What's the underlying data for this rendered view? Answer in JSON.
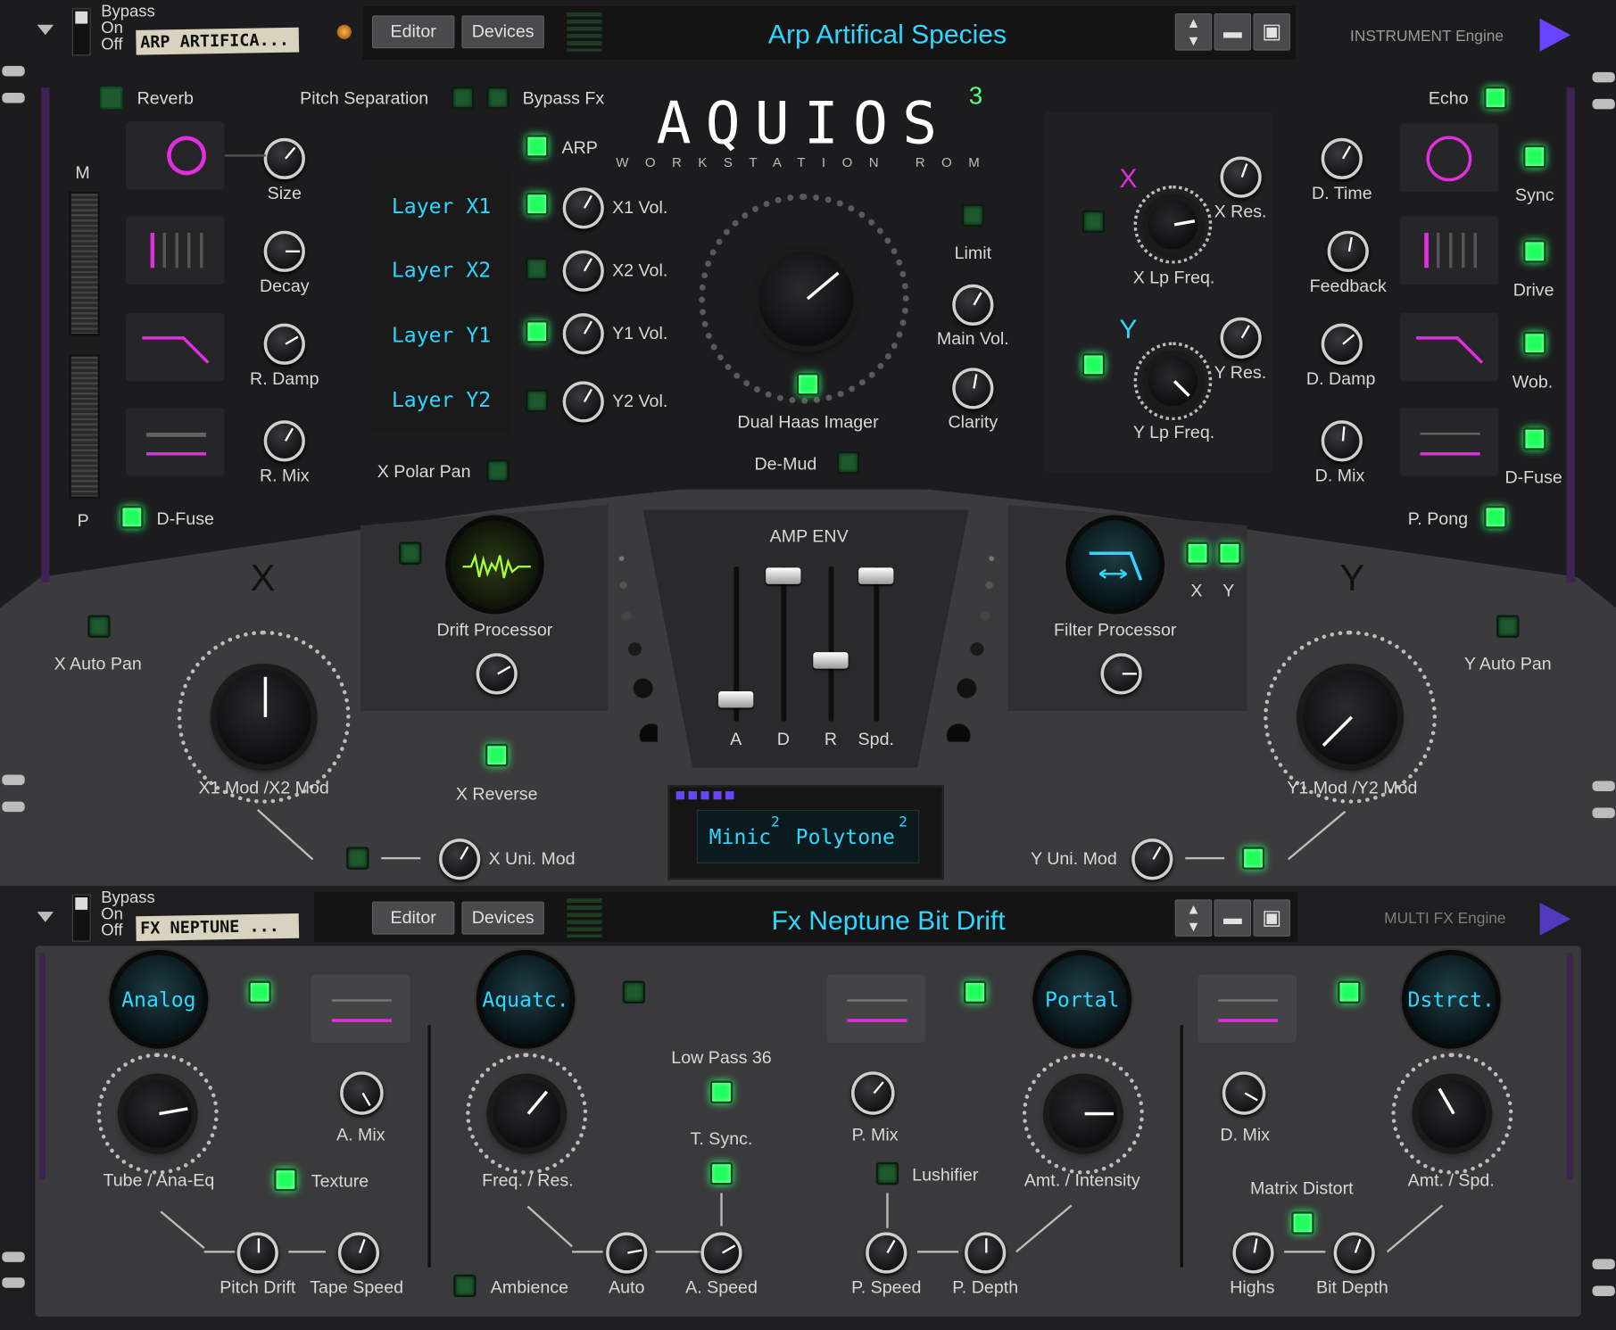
{
  "top_header": {
    "bypass": "Bypass",
    "on": "On",
    "off": "Off",
    "patch_tag": "ARP ARTIFICA...",
    "editor": "Editor",
    "devices": "Devices",
    "patch_name": "Arp Artifical Species",
    "engine": "INSTRUMENT Engine"
  },
  "logo": {
    "name": "AQUIOS",
    "sup": "3",
    "sub": "WORKSTATION ROM"
  },
  "reverb": {
    "title": "Reverb",
    "size": "Size",
    "decay": "Decay",
    "rdamp": "R. Damp",
    "rmix": "R. Mix",
    "dfuse": "D-Fuse",
    "m": "M",
    "p": "P"
  },
  "layers": {
    "pitch_sep": "Pitch Separation",
    "bypass_fx": "Bypass Fx",
    "arp": "ARP",
    "x1": "Layer X1",
    "x2": "Layer X2",
    "y1": "Layer Y1",
    "y2": "Layer Y2",
    "x1vol": "X1 Vol.",
    "x2vol": "X2 Vol.",
    "y1vol": "Y1 Vol.",
    "y2vol": "Y2 Vol.",
    "polar": "X Polar Pan"
  },
  "center": {
    "haas": "Dual Haas Imager",
    "demud": "De-Mud",
    "limit": "Limit",
    "mainvol": "Main Vol.",
    "clarity": "Clarity"
  },
  "filter": {
    "x": "X",
    "y": "Y",
    "xres": "X Res.",
    "xlp": "X Lp Freq.",
    "yres": "Y Res.",
    "ylp": "Y Lp Freq."
  },
  "echo": {
    "title": "Echo",
    "dtime": "D. Time",
    "sync": "Sync",
    "feedback": "Feedback",
    "drive": "Drive",
    "ddamp": "D. Damp",
    "wob": "Wob.",
    "dmix": "D. Mix",
    "dfuse": "D-Fuse",
    "ppong": "P. Pong"
  },
  "mod": {
    "x": "X",
    "y": "Y",
    "xautopan": "X Auto Pan",
    "yautopan": "Y Auto Pan",
    "x1mod": "X1 Mod /X2 Mod",
    "y1mod": "Y1 Mod /Y2 Mod",
    "drift": "Drift Processor",
    "filterproc": "Filter Processor",
    "fx": "X",
    "fy": "Y",
    "xrev": "X Reverse",
    "xuni": "X Uni. Mod",
    "yuni": "Y Uni. Mod"
  },
  "ampenv": {
    "title": "AMP ENV",
    "a": "A",
    "d": "D",
    "r": "R",
    "spd": "Spd.",
    "display": "Minic",
    "disp_sup1": "2",
    "disp2": "Polytone",
    "disp_sup2": "2",
    "levels": [
      0.15,
      0.95,
      0.4,
      0.95
    ]
  },
  "fx_header": {
    "bypass": "Bypass",
    "on": "On",
    "off": "Off",
    "patch_tag": "FX NEPTUNE ...",
    "editor": "Editor",
    "devices": "Devices",
    "patch_name": "Fx Neptune Bit Drift",
    "engine": "MULTI FX Engine"
  },
  "fx1": {
    "orb": "Analog",
    "knob": "Tube / Ana-Eq",
    "amix": "A. Mix",
    "texture": "Texture",
    "pitchdrift": "Pitch Drift",
    "tapespeed": "Tape Speed"
  },
  "fx2": {
    "orb": "Aquatc.",
    "knob": "Freq. / Res.",
    "lowpass": "Low Pass 36",
    "tsync": "T. Sync.",
    "ambience": "Ambience",
    "auto": "Auto",
    "aspeed": "A. Speed"
  },
  "fx3": {
    "orb": "Portal",
    "knob": "Amt. / Intensity",
    "pmix": "P. Mix",
    "lushifier": "Lushifier",
    "pspeed": "P. Speed",
    "pdepth": "P. Depth"
  },
  "fx4": {
    "orb": "Dstrct.",
    "knob": "Amt. / Spd.",
    "dmix": "D. Mix",
    "matrix": "Matrix Distort",
    "highs": "Highs",
    "bitdepth": "Bit Depth"
  },
  "colors": {
    "accent_cyan": "#2fd7ff",
    "magenta": "#e02ee0",
    "led_green": "#20ff5c",
    "panel": "#1f1f21",
    "lower": "#3b3b3d"
  }
}
